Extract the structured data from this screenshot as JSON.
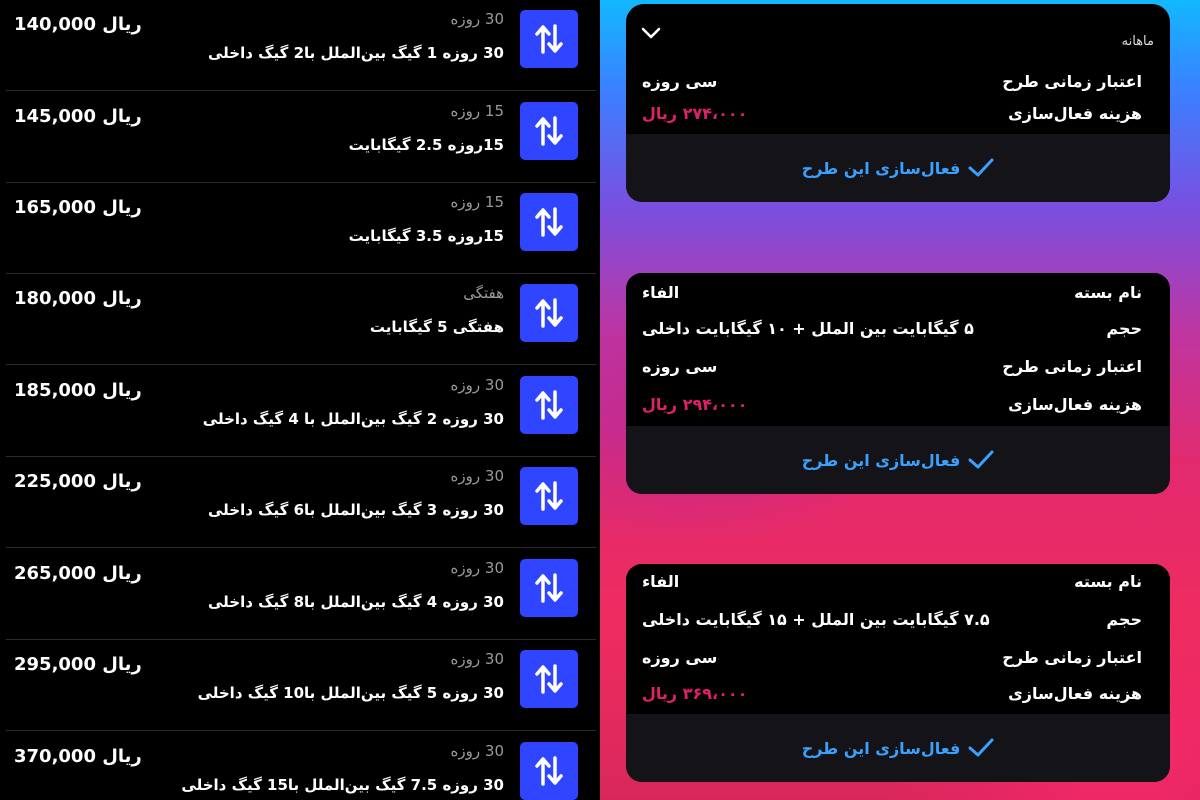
{
  "packages": [
    {
      "duration": "30 روزه",
      "title": "30 روزه 1 گیگ بین‌الملل با2 گیگ داخلی",
      "price": "140,000 ریال"
    },
    {
      "duration": "15 روزه",
      "title": "15روزه 2.5 گیگابایت",
      "price": "145,000 ریال"
    },
    {
      "duration": "15 روزه",
      "title": "15روزه 3.5 گیگابایت",
      "price": "165,000 ریال"
    },
    {
      "duration": "هفتگی",
      "title": "هفتگی 5 گیگابایت",
      "price": "180,000 ریال"
    },
    {
      "duration": "30 روزه",
      "title": "30 روزه 2 گیگ بین‌الملل با 4 گیگ داخلی",
      "price": "185,000 ریال"
    },
    {
      "duration": "30 روزه",
      "title": "30 روزه 3 گیگ بین‌الملل با6 گیگ داخلی",
      "price": "225,000 ریال"
    },
    {
      "duration": "30 روزه",
      "title": "30 روزه 4 گیگ بین‌الملل با8 گیگ داخلی",
      "price": "265,000 ریال"
    },
    {
      "duration": "30 روزه",
      "title": "30 روزه 5 گیگ بین‌الملل با10 گیگ داخلی",
      "price": "295,000 ریال"
    },
    {
      "duration": "30 روزه",
      "title": "30 روزه 7.5 گیگ بین‌الملل با15 گیگ داخلی",
      "price": "370,000 ریال"
    }
  ],
  "icon": "swap-vertical-arrows-icon",
  "colors": {
    "icon_bg": "#2f45ff",
    "price_pink": "#e0206a",
    "link_blue": "#3aa0ff"
  },
  "right": {
    "select_value": "ماهانه",
    "card1": {
      "validity_label": "اعتبار زمانی طرح",
      "validity_value": "سی روزه",
      "cost_label": "هزینه فعال‌سازی",
      "cost_value": "۲۷۴،۰۰۰ ریال",
      "button": "فعال‌سازی این طرح"
    },
    "card2": {
      "name_label": "نام بسته",
      "name_value": "الفاء",
      "volume_label": "حجم",
      "volume_value": "۵ گیگابایت بین الملل + ۱۰ گیگابایت داخلی",
      "validity_label": "اعتبار زمانی طرح",
      "validity_value": "سی روزه",
      "cost_label": "هزینه فعال‌سازی",
      "cost_value": "۲۹۴،۰۰۰ ریال",
      "button": "فعال‌سازی این طرح"
    },
    "card3": {
      "name_label": "نام بسته",
      "name_value": "الفاء",
      "volume_label": "حجم",
      "volume_value": "۷.۵ گیگابایت بین الملل + ۱۵ گیگابایت داخلی",
      "validity_label": "اعتبار زمانی طرح",
      "validity_value": "سی روزه",
      "cost_label": "هزینه فعال‌سازی",
      "cost_value": "۳۶۹،۰۰۰ ریال",
      "button": "فعال‌سازی این طرح"
    }
  }
}
